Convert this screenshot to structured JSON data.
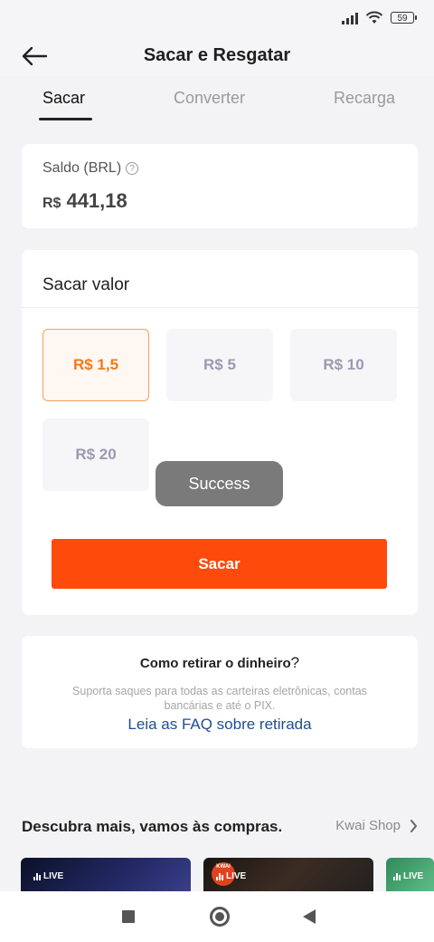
{
  "status_bar": {
    "battery": "59"
  },
  "header": {
    "title": "Sacar e Resgatar"
  },
  "tabs": [
    {
      "label": "Sacar",
      "active": true
    },
    {
      "label": "Converter",
      "active": false
    },
    {
      "label": "Recarga",
      "active": false
    }
  ],
  "balance": {
    "label": "Saldo (BRL)",
    "currency": "R$",
    "amount": "441,18"
  },
  "withdraw": {
    "title": "Sacar valor",
    "options": [
      "R$ 1,5",
      "R$ 5",
      "R$ 10",
      "R$ 20"
    ],
    "selected_index": 0,
    "button_label": "Sacar"
  },
  "toast": {
    "message": "Success"
  },
  "faq": {
    "title": "Como retirar o dinheiro",
    "title_suffix": "?",
    "description": "Suporta saques para todas as carteiras eletrônicas, contas bancárias e até o PIX.",
    "link": "Leia as FAQ sobre retirada"
  },
  "discover": {
    "title": "Descubra mais, vamos às compras.",
    "shop_link": "Kwai Shop",
    "live_badge": "LIVE",
    "thumb_logo": "KWAI"
  },
  "colors": {
    "accent": "#fe4a0b",
    "selected_border": "#f5a25d",
    "selected_text": "#f07a1a",
    "link": "#1f4d93"
  }
}
